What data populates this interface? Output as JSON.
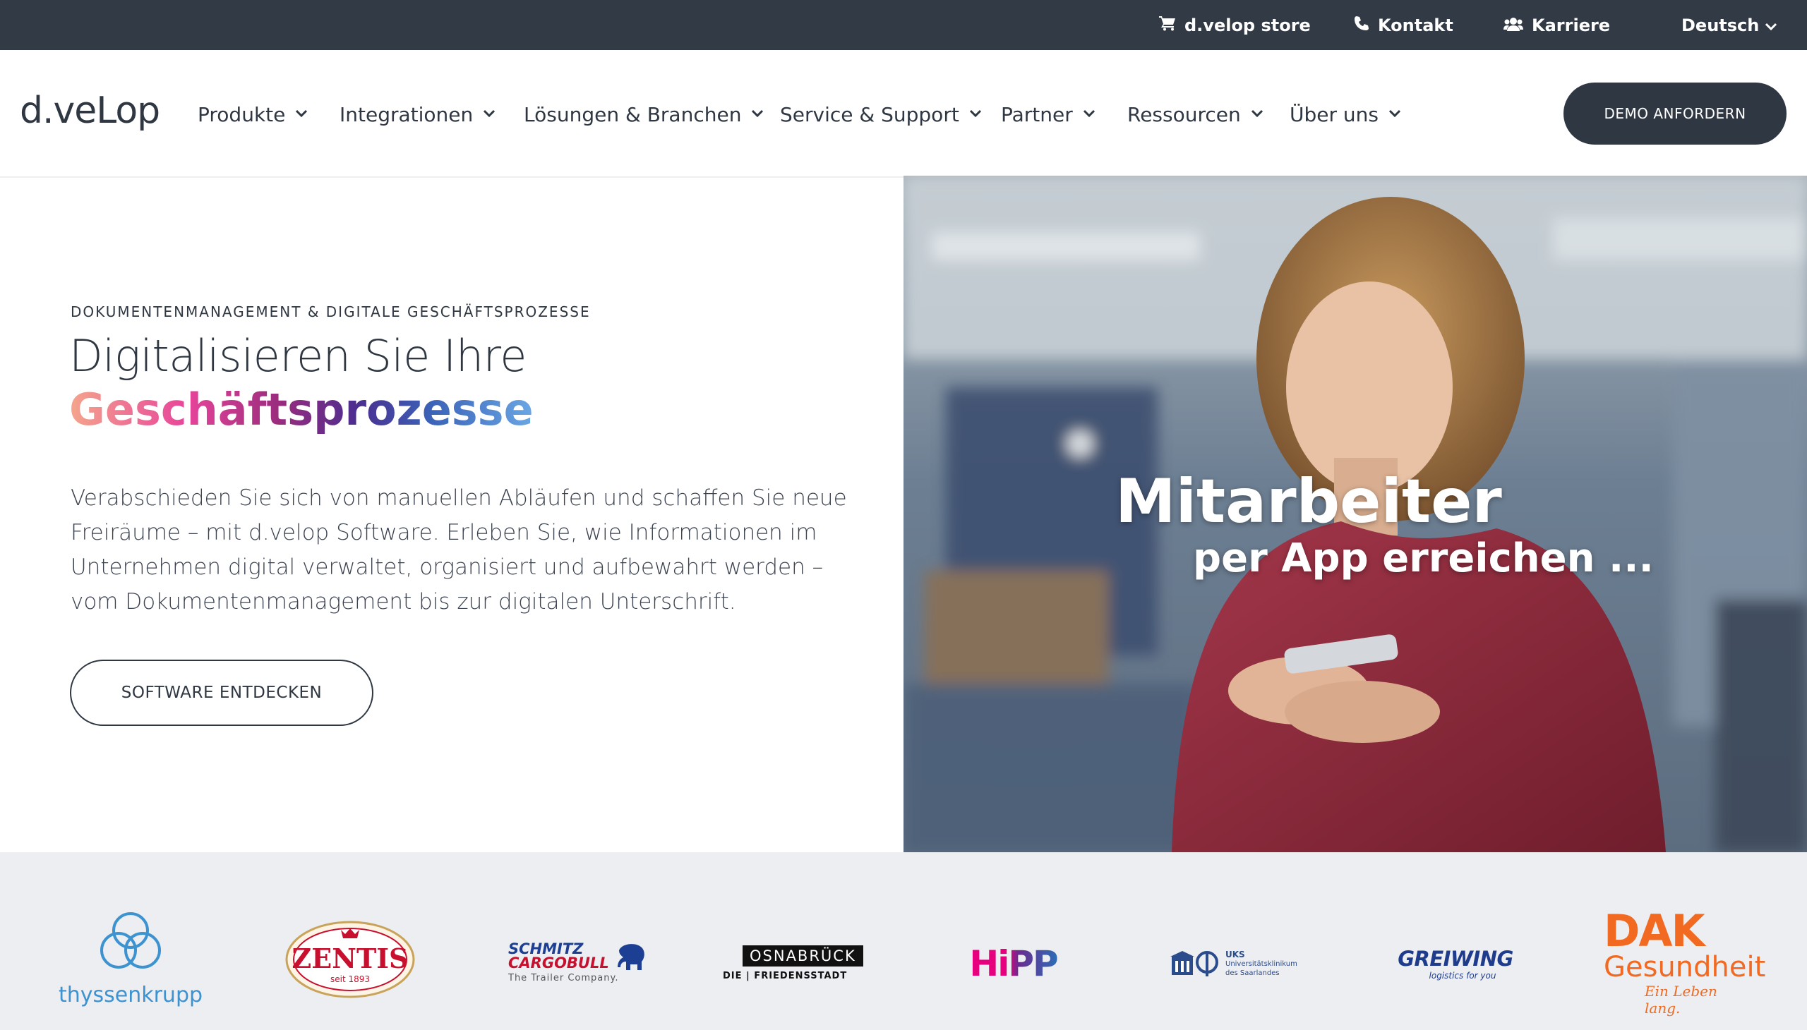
{
  "topbar": {
    "store": "d.velop store",
    "contact": "Kontakt",
    "careers": "Karriere",
    "language": "Deutsch"
  },
  "nav": {
    "logo": "d.veLop",
    "items": [
      {
        "label": "Produkte"
      },
      {
        "label": "Integrationen"
      },
      {
        "label": "Lösungen & Branchen"
      },
      {
        "label": "Service & Support"
      },
      {
        "label": "Partner"
      },
      {
        "label": "Ressourcen"
      },
      {
        "label": "Über uns"
      }
    ],
    "cta": "DEMO ANFORDERN"
  },
  "hero": {
    "eyebrow": "DOKUMENTENMANAGEMENT & DIGITALE GESCHÄFTSPROZESSE",
    "title_line1": "Digitalisieren Sie Ihre",
    "title_line2": "Geschäftsprozesse",
    "lead": "Verabschieden Sie sich von manuellen Abläufen und schaffen Sie neue Freiräume – mit d.velop Software. Erleben Sie, wie Informationen im Unternehmen digital verwaltet, organisiert und aufbewahrt werden – vom Dokumentenmanagement bis zur digitalen Unterschrift.",
    "button": "SOFTWARE ENTDECKEN",
    "media": {
      "overlay_line1": "Mitarbeiter",
      "overlay_line2": "per App erreichen ..."
    }
  },
  "customers": [
    {
      "name": "thyssenkrupp",
      "color": "#3d92d0"
    },
    {
      "name": "ZENTIS",
      "sub": "seit 1893",
      "color": "#c8102e"
    },
    {
      "name": "SCHMITZ",
      "name2": "CARGOBULL",
      "sub": "The Trailer Company.",
      "color": "#1c3f94"
    },
    {
      "name": "OSNABRÜCK",
      "sub": "DIE | FRIEDENSSTADT",
      "color": "#111111"
    },
    {
      "name": "HiPP",
      "color": "#e6007e"
    },
    {
      "name": "UKS",
      "sub1": "Universitätsklinikum",
      "sub2": "des Saarlandes",
      "color": "#2b4c8c"
    },
    {
      "name": "GREIWING",
      "sub": "logistics for you",
      "color": "#1f3c8c"
    },
    {
      "name": "DAK",
      "name2": "Gesundheit",
      "sub": "Ein Leben lang.",
      "color": "#f26a21"
    }
  ]
}
